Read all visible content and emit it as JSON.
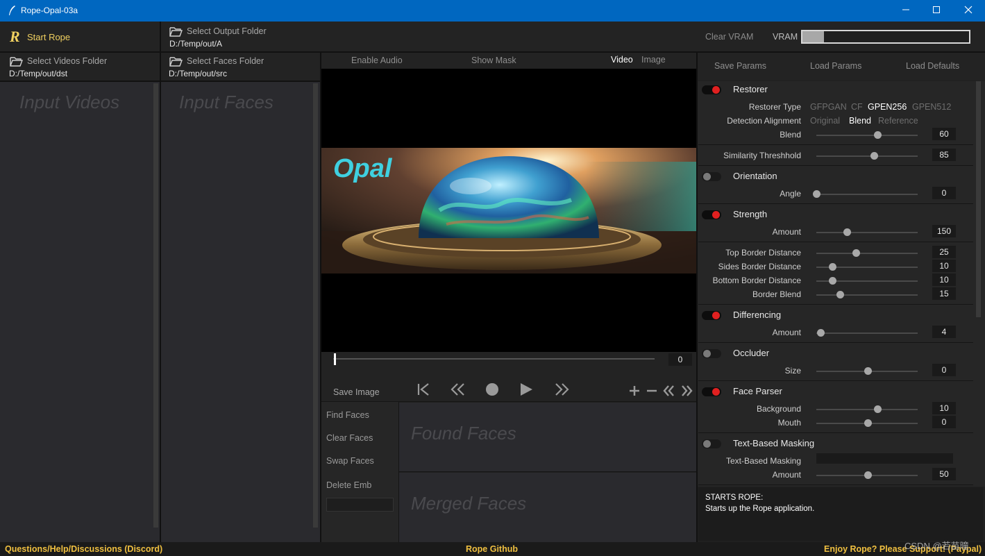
{
  "window": {
    "title": "Rope-Opal-03a",
    "controls": [
      "minimize",
      "maximize",
      "close"
    ]
  },
  "toolbar": {
    "start_rope": "Start Rope",
    "output_folder": {
      "label": "Select Output Folder",
      "path": "D:/Temp/out/A"
    },
    "videos_folder": {
      "label": "Select Videos Folder",
      "path": "D:/Temp/out/dst"
    },
    "faces_folder": {
      "label": "Select Faces Folder",
      "path": "D:/Temp/out/src"
    },
    "clear_vram": "Clear VRAM",
    "vram_label": "VRAM",
    "vram_usage": 0.13
  },
  "panes": {
    "input_videos": "Input Videos",
    "input_faces": "Input Faces"
  },
  "center": {
    "enable_audio": "Enable Audio",
    "show_mask": "Show Mask",
    "tab_video": "Video",
    "tab_image": "Image",
    "preview_text": "Opal",
    "frame_value": "0",
    "save_image": "Save Image",
    "find_faces": "Find Faces",
    "clear_faces": "Clear Faces",
    "swap_faces": "Swap Faces",
    "delete_emb": "Delete Emb",
    "found_faces": "Found Faces",
    "merged_faces": "Merged Faces"
  },
  "params_header": {
    "save": "Save Params",
    "load": "Load Params",
    "defaults": "Load Defaults"
  },
  "params": {
    "restorer": {
      "title": "Restorer",
      "on": true,
      "type_label": "Restorer Type",
      "types": [
        "GFPGAN",
        "CF",
        "GPEN256",
        "GPEN512"
      ],
      "type_selected": "GPEN256",
      "align_label": "Detection Alignment",
      "aligns": [
        "Original",
        "Blend",
        "Reference"
      ],
      "align_selected": "Blend",
      "blend_label": "Blend",
      "blend_value": "60"
    },
    "similarity": {
      "label": "Similarity Threshhold",
      "value": "85"
    },
    "orientation": {
      "title": "Orientation",
      "on": false,
      "angle_label": "Angle",
      "angle_value": "0"
    },
    "strength": {
      "title": "Strength",
      "on": true,
      "amount_label": "Amount",
      "amount_value": "150"
    },
    "border": {
      "top_label": "Top Border Distance",
      "top_value": "25",
      "sides_label": "Sides Border Distance",
      "sides_value": "10",
      "bottom_label": "Bottom Border Distance",
      "bottom_value": "10",
      "blend_label": "Border Blend",
      "blend_value": "15"
    },
    "differencing": {
      "title": "Differencing",
      "on": true,
      "amount_label": "Amount",
      "amount_value": "4"
    },
    "occluder": {
      "title": "Occluder",
      "on": false,
      "size_label": "Size",
      "size_value": "0"
    },
    "face_parser": {
      "title": "Face Parser",
      "on": true,
      "bg_label": "Background",
      "bg_value": "10",
      "mouth_label": "Mouth",
      "mouth_value": "0"
    },
    "text_masking": {
      "title": "Text-Based Masking",
      "on": false,
      "text_label": "Text-Based Masking",
      "amount_label": "Amount",
      "amount_value": "50"
    }
  },
  "info": {
    "title": "STARTS ROPE:",
    "body": "Starts up the Rope application."
  },
  "footer": {
    "discord": "Questions/Help/Discussions (Discord)",
    "github": "Rope Github",
    "paypal": "Enjoy Rope? Please Support! (Paypal)",
    "watermark": "CSDN @若苗曈"
  },
  "colors": {
    "titlebar": "#0067c0",
    "accent_yellow": "#f0c040",
    "toggle_on": "#e02020"
  }
}
